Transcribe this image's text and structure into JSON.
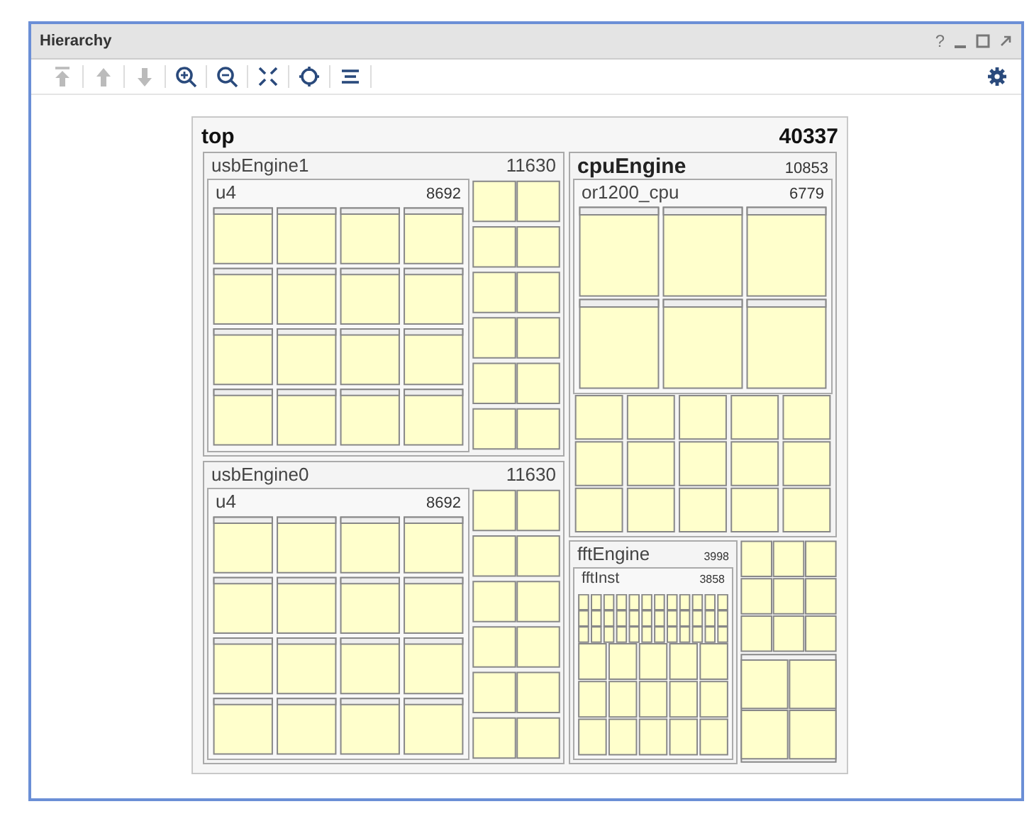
{
  "window": {
    "title": "Hierarchy",
    "help": "?"
  },
  "toolbar": [
    {
      "kind": "top",
      "disabled": true
    },
    {
      "kind": "up",
      "disabled": true
    },
    {
      "kind": "down",
      "disabled": true
    },
    {
      "kind": "zoom-in",
      "disabled": false
    },
    {
      "kind": "zoom-out",
      "disabled": false
    },
    {
      "kind": "fit",
      "disabled": false
    },
    {
      "kind": "center",
      "disabled": false
    },
    {
      "kind": "layout",
      "disabled": false
    }
  ],
  "treemap": {
    "name": "top",
    "count": "40337",
    "usb_engines": [
      {
        "name": "usbEngine1",
        "count": "11630",
        "child": {
          "name": "u4",
          "count": "8692"
        }
      },
      {
        "name": "usbEngine0",
        "count": "11630",
        "child": {
          "name": "u4",
          "count": "8692"
        }
      }
    ],
    "cpu": {
      "name": "cpuEngine",
      "count": "10853",
      "child": {
        "name": "or1200_cpu",
        "count": "6779"
      }
    },
    "fft": {
      "name": "fftEngine",
      "count": "3998",
      "child": {
        "name": "fftInst",
        "count": "3858"
      }
    }
  }
}
